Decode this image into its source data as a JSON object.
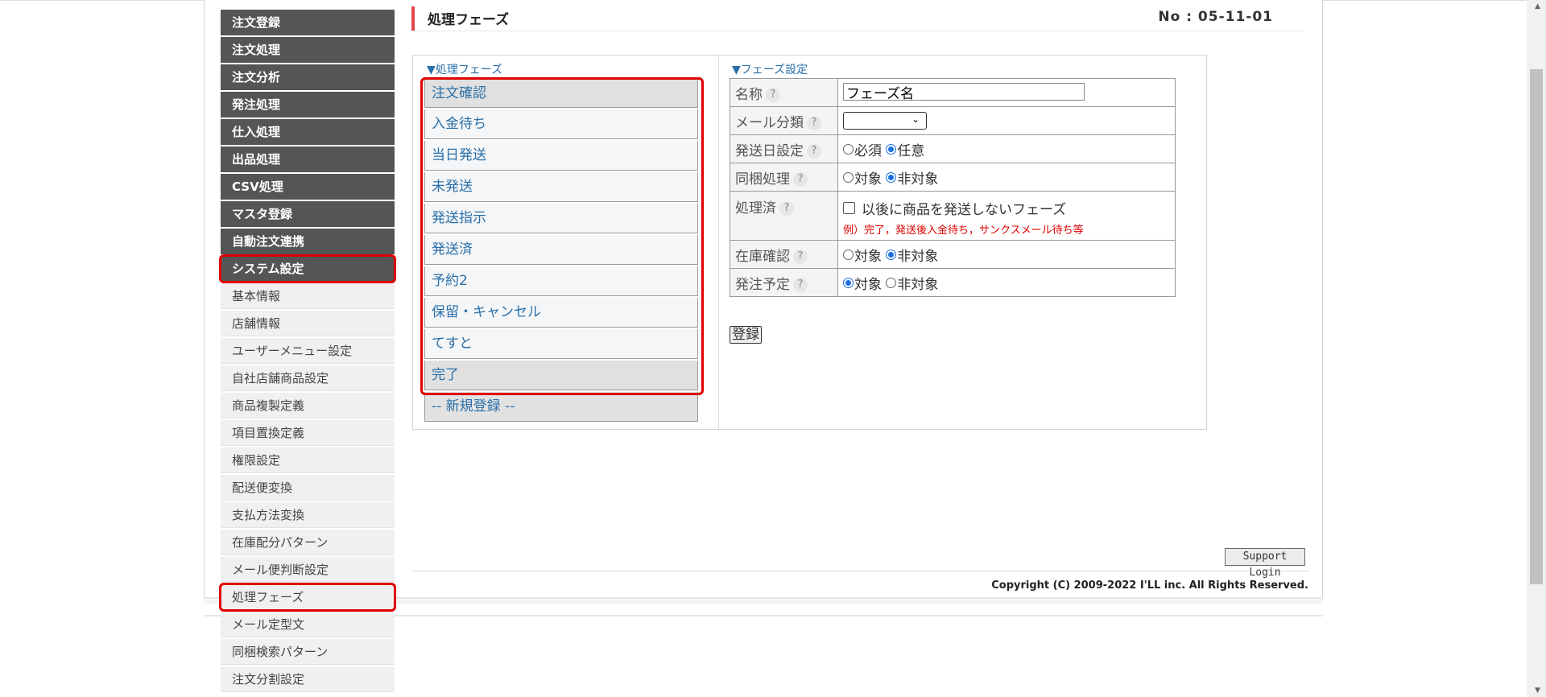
{
  "header": {
    "title": "処理フェーズ",
    "page_no": "No : 05-11-01"
  },
  "sidebar": {
    "main_items": [
      {
        "label": "注文登録"
      },
      {
        "label": "注文処理"
      },
      {
        "label": "注文分析"
      },
      {
        "label": "発注処理"
      },
      {
        "label": "仕入処理"
      },
      {
        "label": "出品処理"
      },
      {
        "label": "CSV処理"
      },
      {
        "label": "マスタ登録"
      },
      {
        "label": "自動注文連携"
      },
      {
        "label": "システム設定"
      }
    ],
    "sub_items": [
      {
        "label": "基本情報"
      },
      {
        "label": "店舗情報"
      },
      {
        "label": "ユーザーメニュー設定"
      },
      {
        "label": "自社店舗商品設定"
      },
      {
        "label": "商品複製定義"
      },
      {
        "label": "項目置換定義"
      },
      {
        "label": "権限設定"
      },
      {
        "label": "配送便変換"
      },
      {
        "label": "支払方法変換"
      },
      {
        "label": "在庫配分パターン"
      },
      {
        "label": "メール便判断設定"
      },
      {
        "label": "処理フェーズ"
      },
      {
        "label": "メール定型文"
      },
      {
        "label": "同梱検索パターン"
      },
      {
        "label": "注文分割設定"
      }
    ]
  },
  "phases": {
    "heading": "▼処理フェーズ",
    "items": [
      {
        "label": "注文確認"
      },
      {
        "label": "入金待ち"
      },
      {
        "label": "当日発送"
      },
      {
        "label": "未発送"
      },
      {
        "label": "発送指示"
      },
      {
        "label": "発送済"
      },
      {
        "label": "予約2"
      },
      {
        "label": "保留・キャンセル"
      },
      {
        "label": "てすと"
      },
      {
        "label": "完了"
      }
    ],
    "new_label": "-- 新規登録 --"
  },
  "settings": {
    "heading": "▼フェーズ設定",
    "help": "?",
    "name": {
      "label": "名称",
      "value": "フェーズ名"
    },
    "mail": {
      "label": "メール分類",
      "value": ""
    },
    "ship_date": {
      "label": "発送日設定",
      "opt1": "必須",
      "opt2": "任意"
    },
    "bundle": {
      "label": "同梱処理",
      "opt1": "対象",
      "opt2": "非対象"
    },
    "done": {
      "label": "処理済",
      "checkbox_text": "以後に商品を発送しないフェーズ",
      "note": "例）完了，発送後入金待ち，サンクスメール待ち等"
    },
    "stock": {
      "label": "在庫確認",
      "opt1": "対象",
      "opt2": "非対象"
    },
    "order_plan": {
      "label": "発注予定",
      "opt1": "対象",
      "opt2": "非対象"
    },
    "register_button": "登録"
  },
  "footer": {
    "support_button": "Support Login",
    "copyright": "Copyright (C) 2009-2022 I'LL inc. All Rights Reserved."
  },
  "colors": {
    "accent_red": "#e00000",
    "link_blue": "#2a6fa8",
    "menu_dark": "#555555",
    "title_mark": "#e0464a"
  }
}
